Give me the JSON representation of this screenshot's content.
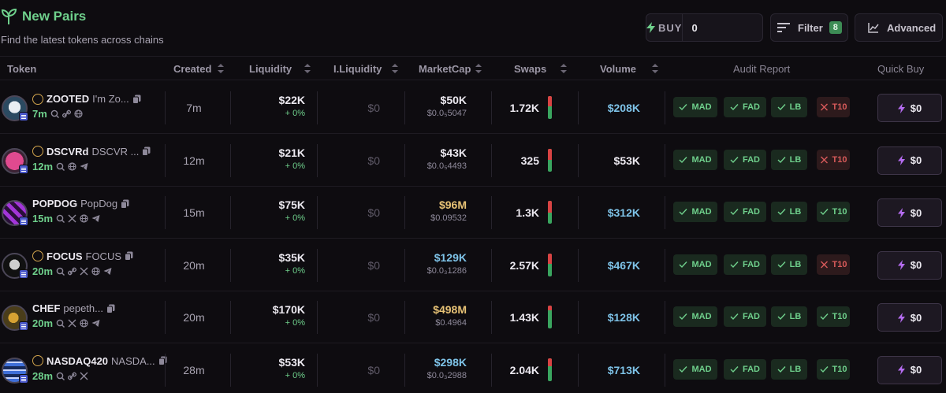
{
  "header": {
    "title": "New Pairs",
    "subtitle": "Find the latest tokens across chains",
    "buy_label": "BUY",
    "buy_value": "0",
    "buy_currency": "$",
    "filter_label": "Filter",
    "filter_count": "8",
    "advanced_label": "Advanced"
  },
  "columns": {
    "token": "Token",
    "created": "Created",
    "liquidity": "Liquidity",
    "initial_liquidity": "I.Liquidity",
    "marketcap": "MarketCap",
    "swaps": "Swaps",
    "volume": "Volume",
    "audit": "Audit Report",
    "quick_buy": "Quick Buy"
  },
  "colors": {
    "accent_green": "#6fd08c",
    "accent_red": "#d85a5a",
    "volume_blue": "#7ec3e8",
    "mc_gold": "#e8c376",
    "white": "#ece9f0",
    "purple_bolt": "#b56cf0"
  },
  "rows": [
    {
      "symbol": "ZOOTED",
      "name": "I'm Zo...",
      "age": "7m",
      "dex_icon": "pump-icon",
      "socials": [
        "search-icon",
        "link-icon",
        "globe-icon"
      ],
      "created": "7m",
      "liquidity": "$22K",
      "liq_change": "+ 0%",
      "initial_liquidity": "$0",
      "marketcap": "$50K",
      "mc_color": "#ece9f0",
      "price": "$0.0₅5047",
      "swaps": "1.72K",
      "sell_ratio": 0.45,
      "volume": "$208K",
      "vol_color": "#7ec3e8",
      "audit": [
        {
          "label": "MAD",
          "ok": true
        },
        {
          "label": "FAD",
          "ok": true
        },
        {
          "label": "LB",
          "ok": true
        },
        {
          "label": "T10",
          "ok": false
        }
      ],
      "quick_buy": "$0"
    },
    {
      "symbol": "DSCVRd",
      "name": "DSCVR ...",
      "age": "12m",
      "dex_icon": "moonshot-icon",
      "socials": [
        "search-icon",
        "globe-icon",
        "telegram-icon"
      ],
      "created": "12m",
      "liquidity": "$21K",
      "liq_change": "+ 0%",
      "initial_liquidity": "$0",
      "marketcap": "$43K",
      "mc_color": "#ece9f0",
      "price": "$0.0₅4493",
      "swaps": "325",
      "sell_ratio": 0.5,
      "volume": "$53K",
      "vol_color": "#ece9f0",
      "audit": [
        {
          "label": "MAD",
          "ok": true
        },
        {
          "label": "FAD",
          "ok": true
        },
        {
          "label": "LB",
          "ok": true
        },
        {
          "label": "T10",
          "ok": false
        }
      ],
      "quick_buy": "$0"
    },
    {
      "symbol": "POPDOG",
      "name": "PopDog",
      "age": "15m",
      "dex_icon": "",
      "socials": [
        "search-icon",
        "x-icon",
        "globe-icon",
        "telegram-icon"
      ],
      "created": "15m",
      "liquidity": "$75K",
      "liq_change": "+ 0%",
      "initial_liquidity": "$0",
      "marketcap": "$96M",
      "mc_color": "#e8c376",
      "price": "$0.09532",
      "swaps": "1.3K",
      "sell_ratio": 0.5,
      "volume": "$312K",
      "vol_color": "#7ec3e8",
      "audit": [
        {
          "label": "MAD",
          "ok": true
        },
        {
          "label": "FAD",
          "ok": true
        },
        {
          "label": "LB",
          "ok": true
        },
        {
          "label": "T10",
          "ok": true
        }
      ],
      "quick_buy": "$0"
    },
    {
      "symbol": "FOCUS",
      "name": "FOCUS",
      "age": "20m",
      "dex_icon": "pump-icon",
      "socials": [
        "search-icon",
        "link-icon",
        "x-icon",
        "globe-icon",
        "telegram-icon"
      ],
      "created": "20m",
      "liquidity": "$35K",
      "liq_change": "+ 0%",
      "initial_liquidity": "$0",
      "marketcap": "$129K",
      "mc_color": "#7ec3e8",
      "price": "$0.0₃1286",
      "swaps": "2.57K",
      "sell_ratio": 0.45,
      "volume": "$467K",
      "vol_color": "#7ec3e8",
      "audit": [
        {
          "label": "MAD",
          "ok": true
        },
        {
          "label": "FAD",
          "ok": true
        },
        {
          "label": "LB",
          "ok": true
        },
        {
          "label": "T10",
          "ok": false
        }
      ],
      "quick_buy": "$0"
    },
    {
      "symbol": "CHEF",
      "name": "pepeth...",
      "age": "20m",
      "dex_icon": "",
      "socials": [
        "search-icon",
        "x-icon",
        "globe-icon",
        "telegram-icon"
      ],
      "created": "20m",
      "liquidity": "$170K",
      "liq_change": "+ 0%",
      "initial_liquidity": "$0",
      "marketcap": "$498M",
      "mc_color": "#e8c376",
      "price": "$0.4964",
      "swaps": "1.43K",
      "sell_ratio": 0.2,
      "volume": "$128K",
      "vol_color": "#7ec3e8",
      "audit": [
        {
          "label": "MAD",
          "ok": true
        },
        {
          "label": "FAD",
          "ok": true
        },
        {
          "label": "LB",
          "ok": true
        },
        {
          "label": "T10",
          "ok": true
        }
      ],
      "quick_buy": "$0"
    },
    {
      "symbol": "NASDAQ420",
      "name": "NASDA...",
      "age": "28m",
      "dex_icon": "pump-icon",
      "socials": [
        "search-icon",
        "link-icon",
        "x-icon"
      ],
      "created": "28m",
      "liquidity": "$53K",
      "liq_change": "+ 0%",
      "initial_liquidity": "$0",
      "marketcap": "$298K",
      "mc_color": "#7ec3e8",
      "price": "$0.0₃2988",
      "swaps": "2.04K",
      "sell_ratio": 0.35,
      "volume": "$713K",
      "vol_color": "#7ec3e8",
      "audit": [
        {
          "label": "MAD",
          "ok": true
        },
        {
          "label": "FAD",
          "ok": true
        },
        {
          "label": "LB",
          "ok": true
        },
        {
          "label": "T10",
          "ok": true
        }
      ],
      "quick_buy": "$0"
    }
  ]
}
